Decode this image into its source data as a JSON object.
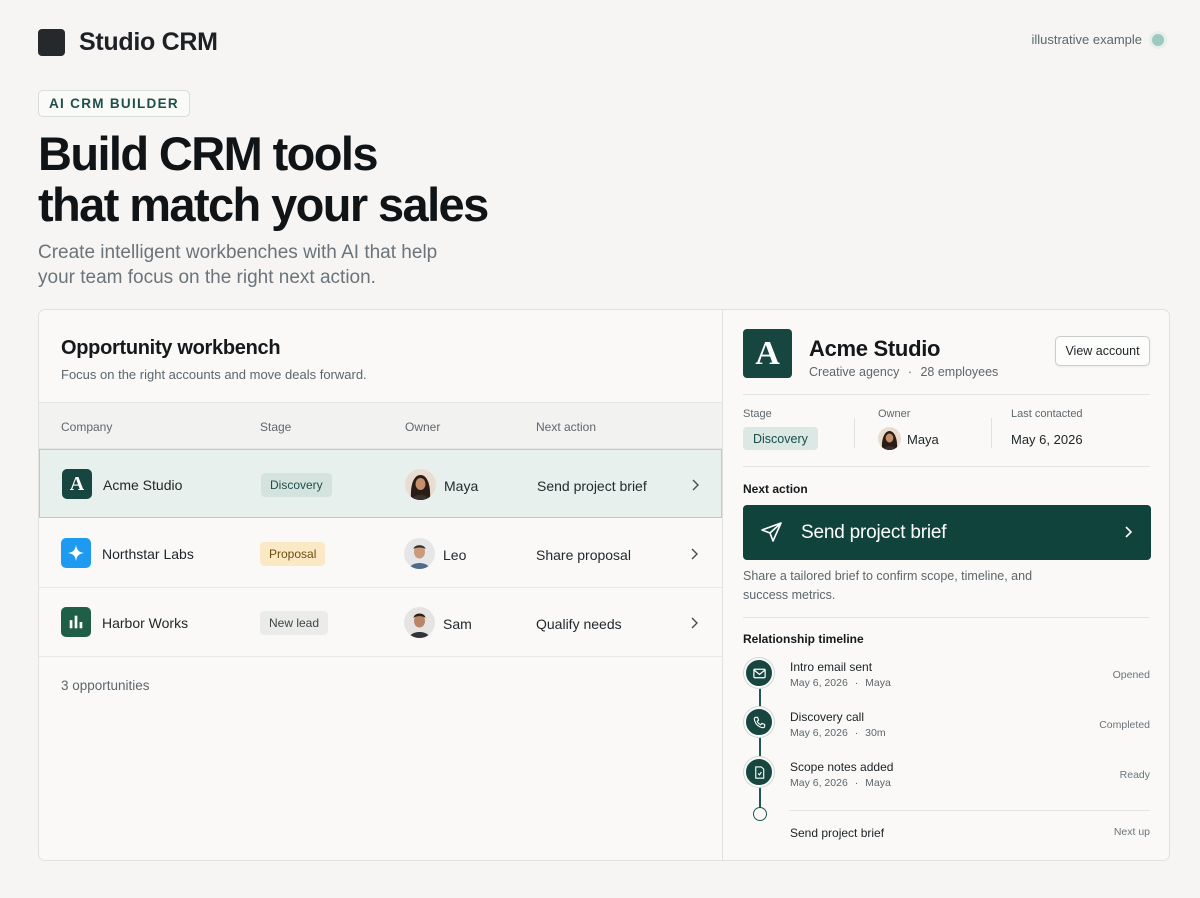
{
  "brand": {
    "name": "Studio CRM"
  },
  "meta_note": "illustrative example",
  "hero": {
    "eyebrow": "AI CRM BUILDER",
    "headline_line1": "Build CRM tools",
    "headline_line2": "that match your sales",
    "sub_line1": "Create intelligent workbenches with AI that help",
    "sub_line2": "your team focus on the right next action."
  },
  "workbench": {
    "title": "Opportunity workbench",
    "subtitle": "Focus on the right accounts and move deals forward.",
    "columns": [
      "Company",
      "Stage",
      "Owner",
      "Next action"
    ],
    "rows": [
      {
        "company": "Acme Studio",
        "icon": "acme-logo-icon",
        "stage": "Discovery",
        "owner": "Maya",
        "next_action": "Send project brief",
        "selected": true
      },
      {
        "company": "Northstar Labs",
        "icon": "northstar-sparkle-icon",
        "stage": "Proposal",
        "owner": "Leo",
        "next_action": "Share proposal",
        "selected": false
      },
      {
        "company": "Harbor Works",
        "icon": "harbor-bars-icon",
        "stage": "New lead",
        "owner": "Sam",
        "next_action": "Qualify needs",
        "selected": false
      }
    ],
    "footer": "3 opportunities"
  },
  "account": {
    "logo_letter": "A",
    "name": "Acme Studio",
    "industry": "Creative agency",
    "separator": "·",
    "employees": "28 employees",
    "view_button": "View account",
    "stage_label": "Stage",
    "stage": "Discovery",
    "owner_label": "Owner",
    "owner": "Maya",
    "last_contacted_label": "Last contacted",
    "last_contacted": "May 6, 2026",
    "next_action_label": "Next action",
    "next_action": "Send project brief",
    "next_action_desc": "Share a tailored brief to confirm scope, timeline, and success metrics.",
    "timeline_label": "Relationship timeline",
    "timeline": [
      {
        "title": "Intro email sent",
        "date": "May 6, 2026",
        "sep": "·",
        "detail": "Maya",
        "status": "Opened",
        "icon": "mail-icon"
      },
      {
        "title": "Discovery call",
        "date": "May 6, 2026",
        "sep": "·",
        "detail": "30m",
        "status": "Completed",
        "icon": "phone-icon"
      },
      {
        "title": "Scope notes added",
        "date": "May 6, 2026",
        "sep": "·",
        "detail": "Maya",
        "status": "Ready",
        "icon": "document-icon"
      },
      {
        "title": "Send project brief",
        "status": "Next up"
      }
    ]
  },
  "colors": {
    "accent": "#11433d",
    "discovery_badge": "#dbe8e4",
    "proposal_badge": "#fbe9c6",
    "newlead_badge": "#ebebea",
    "northstar": "#1e9bf0",
    "harbor": "#1f5f48"
  }
}
